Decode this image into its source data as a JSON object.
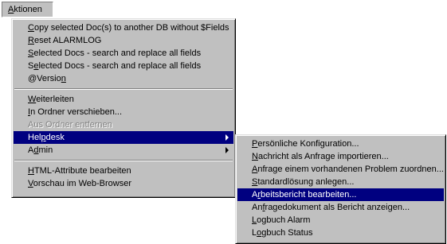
{
  "menubar": {
    "label_u": "A",
    "label_rest": "ktionen"
  },
  "main_menu": {
    "group1": [
      {
        "pre": "",
        "u": "C",
        "post": "opy selected Doc(s) to another DB without $Fields"
      },
      {
        "pre": "",
        "u": "R",
        "post": "eset ALARMLOG"
      },
      {
        "pre": "",
        "u": "S",
        "post": "elected Docs - search and replace all fields"
      },
      {
        "pre": "S",
        "u": "e",
        "post": "lected Docs - search and replace all fields"
      },
      {
        "pre": "@Versio",
        "u": "n",
        "post": ""
      }
    ],
    "group2": [
      {
        "pre": "",
        "u": "W",
        "post": "eiterleiten"
      },
      {
        "pre": "",
        "u": "I",
        "post": "n Ordner verschieben..."
      },
      {
        "pre": "Aus Ordner entfernen",
        "u": "",
        "post": ""
      },
      {
        "pre": "Hel",
        "u": "p",
        "post": "desk"
      },
      {
        "pre": "A",
        "u": "d",
        "post": "min"
      }
    ],
    "group3": [
      {
        "pre": "",
        "u": "H",
        "post": "TML-Attribute bearbeiten"
      },
      {
        "pre": "",
        "u": "V",
        "post": "orschau im Web-Browser"
      }
    ]
  },
  "sub_menu": {
    "items": [
      {
        "pre": "",
        "u": "P",
        "post": "ersönliche Konfiguration..."
      },
      {
        "pre": "",
        "u": "N",
        "post": "achricht als Anfrage importieren..."
      },
      {
        "pre": "",
        "u": "A",
        "post": "nfrage einem vorhandenen Problem zuordnen..."
      },
      {
        "pre": "",
        "u": "S",
        "post": "tandardlösung anlegen..."
      },
      {
        "pre": "A",
        "u": "r",
        "post": "beitsbericht bearbeiten..."
      },
      {
        "pre": "An",
        "u": "f",
        "post": "ragedokument als Bericht anzeigen..."
      },
      {
        "pre": "",
        "u": "L",
        "post": "ogbuch Alarm"
      },
      {
        "pre": "L",
        "u": "o",
        "post": "gbuch Status"
      }
    ]
  },
  "colors": {
    "menu_face": "#c0c0c0",
    "highlight": "#000080",
    "disabled_text": "#808080"
  }
}
